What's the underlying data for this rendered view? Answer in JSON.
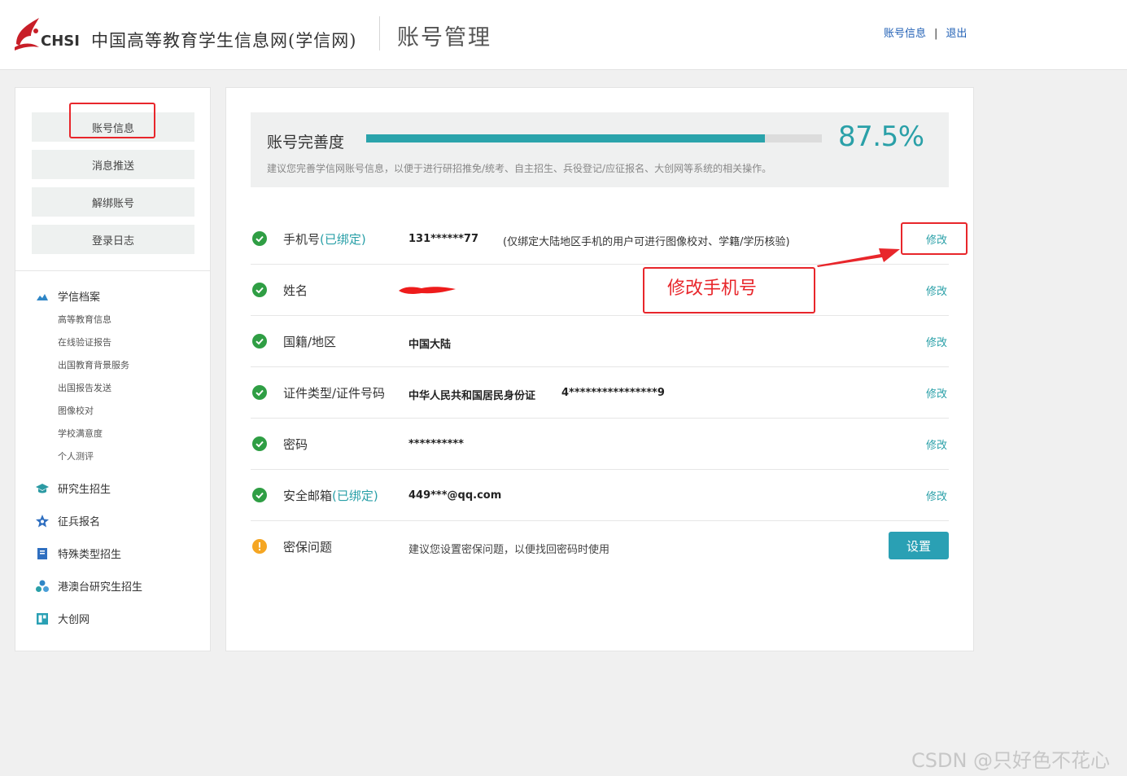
{
  "header": {
    "logo_text": "CHSI",
    "site_name": "中国高等教育学生信息网(学信网)",
    "page_title": "账号管理",
    "links": [
      "账号信息",
      "退出"
    ],
    "separator": "|"
  },
  "sidebar": {
    "buttons": [
      "账号信息",
      "消息推送",
      "解绑账号",
      "登录日志"
    ],
    "sections": [
      {
        "label": "学信档案",
        "icon": "cloud-icon",
        "items": [
          "高等教育信息",
          "在线验证报告",
          "出国教育背景服务",
          "出国报告发送",
          "图像校对",
          "学校满意度",
          "个人测评"
        ]
      },
      {
        "label": "研究生招生",
        "icon": "graduation-cap-icon",
        "items": []
      },
      {
        "label": "征兵报名",
        "icon": "star-icon",
        "items": []
      },
      {
        "label": "特殊类型招生",
        "icon": "book-icon",
        "items": []
      },
      {
        "label": "港澳台研究生招生",
        "icon": "people-icon",
        "items": []
      },
      {
        "label": "大创网",
        "icon": "dachuang-icon",
        "items": []
      }
    ]
  },
  "progress": {
    "label": "账号完善度",
    "percent_text": "87.5%",
    "percent": 87.5,
    "hint": "建议您完善学信网账号信息，以便于进行研招推免/统考、自主招生、兵役登记/应征报名、大创网等系统的相关操作。"
  },
  "rows": [
    {
      "label": "手机号",
      "bound": "(已绑定)",
      "value": "131******77",
      "note": "(仅绑定大陆地区手机的用户可进行图像校对、学籍/学历核验)",
      "action": "修改",
      "status": "ok"
    },
    {
      "label": "姓名",
      "bound": "",
      "value": "",
      "note": "",
      "action": "修改",
      "status": "ok"
    },
    {
      "label": "国籍/地区",
      "bound": "",
      "value": "中国大陆",
      "note": "",
      "action": "修改",
      "status": "ok"
    },
    {
      "label": "证件类型/证件号码",
      "bound": "",
      "value": "中华人民共和国居民身份证",
      "value2": "4****************9",
      "action": "修改",
      "status": "ok"
    },
    {
      "label": "密码",
      "bound": "",
      "value": "**********",
      "note": "",
      "action": "修改",
      "status": "ok"
    },
    {
      "label": "安全邮箱",
      "bound": "(已绑定)",
      "value": "449***@qq.com",
      "note": "",
      "action": "修改",
      "status": "ok"
    },
    {
      "label": "密保问题",
      "bound": "",
      "hint": "建议您设置密保问题，以便找回密码时使用",
      "action": "设置",
      "status": "warn"
    }
  ],
  "annotation": {
    "text": "修改手机号",
    "color": "#e8262b"
  },
  "watermark": "CSDN @只好色不花心",
  "colors": {
    "accent": "#2aa0a8",
    "ok_green": "#2f9e44",
    "warn_orange": "#f5a623",
    "link_blue": "#2160b5"
  }
}
